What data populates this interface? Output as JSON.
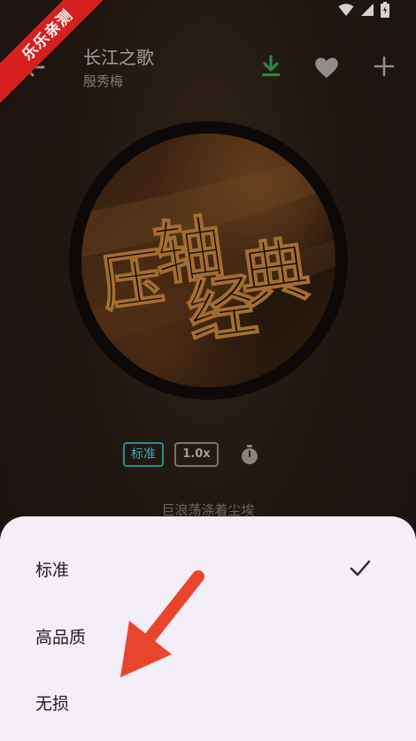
{
  "watermark": {
    "text": "乐乐亲测"
  },
  "header": {
    "title": "长江之歌",
    "artist": "殷秀梅",
    "back_icon": "arrow-left-icon",
    "download_icon": "download-icon",
    "favorite_icon": "heart-icon",
    "add_icon": "plus-icon"
  },
  "album": {
    "art_text": "压轴经典"
  },
  "controls": {
    "quality_label": "标准",
    "speed_label": "1.0x",
    "timer_icon": "timer-icon"
  },
  "lyrics": {
    "current_line": "巨浪荡涤着尘埃"
  },
  "quality_sheet": {
    "options": [
      {
        "label": "标准",
        "selected": true
      },
      {
        "label": "高品质",
        "selected": false
      },
      {
        "label": "无损",
        "selected": false
      }
    ],
    "check_icon": "check-icon"
  },
  "colors": {
    "accent": "#3fa6b0",
    "download_green": "#3aa05a",
    "sheet_bg": "#f4eef7",
    "arrow_red": "#e8452c"
  }
}
